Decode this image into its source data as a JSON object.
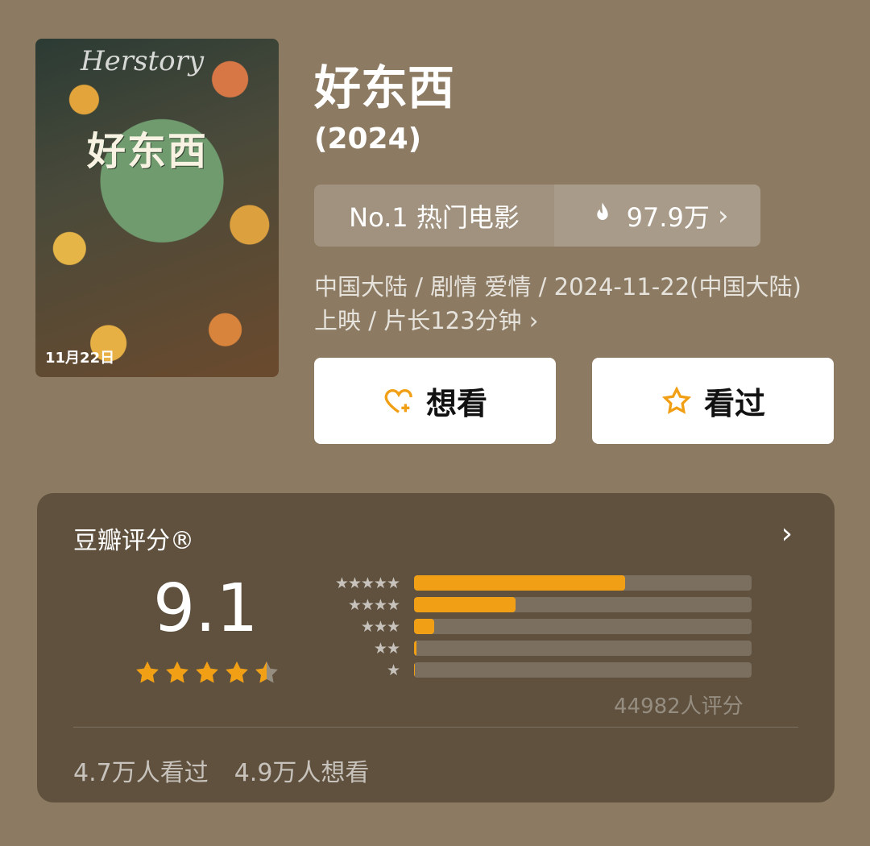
{
  "movie": {
    "title": "好东西",
    "year": "(2024)",
    "poster": {
      "logo": "Herstory",
      "title": "好东西",
      "date": "11月22日"
    },
    "rank": {
      "label": "No.1 热门电影",
      "hot_count": "97.9万"
    },
    "meta": "中国大陆 / 剧情 爱情 / 2024-11-22(中国大陆)上映 / 片长123分钟 ›",
    "actions": {
      "want": "想看",
      "seen": "看过"
    }
  },
  "rating": {
    "title": "豆瓣评分®",
    "score": "9.1",
    "stars": 4.5,
    "distribution": [
      {
        "stars": 5,
        "label": "★★★★★",
        "percent": 62.5
      },
      {
        "stars": 4,
        "label": "★★★★",
        "percent": 30.0
      },
      {
        "stars": 3,
        "label": "★★★",
        "percent": 6.0
      },
      {
        "stars": 2,
        "label": "★★",
        "percent": 0.8
      },
      {
        "stars": 1,
        "label": "★",
        "percent": 0.2
      }
    ],
    "count": "44982人评分",
    "seen": "4.7万人看过",
    "want": "4.9万人想看"
  },
  "colors": {
    "accent": "#f1a015",
    "background": "#8c7b62"
  }
}
